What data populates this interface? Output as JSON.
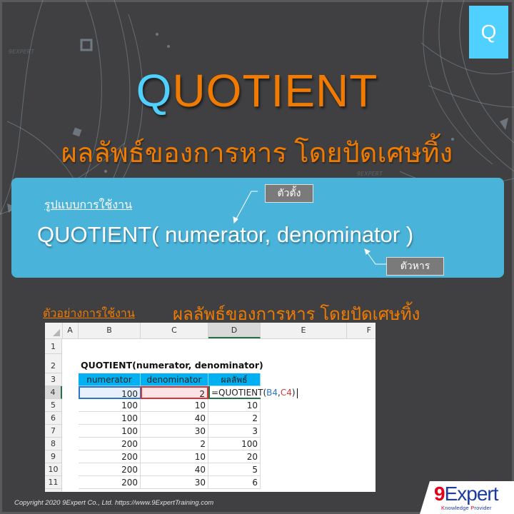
{
  "badge": {
    "letter": "Q"
  },
  "header": {
    "title_first_letter": "Q",
    "title_rest": "UOTIENT",
    "subtitle": "ผลลัพธ์ของการหาร โดยปัดเศษทิ้ง"
  },
  "syntax_panel": {
    "usage_label": "รูปแบบการใช้งาน",
    "syntax": "QUOTIENT( numerator, denominator )",
    "callout_numerator": "ตัวตั้ง",
    "callout_denominator": "ตัวหาร"
  },
  "example": {
    "label": "ตัวอย่างการใช้งาน",
    "title": "ผลลัพธ์ของการหาร โดยปัดเศษทิ้ง"
  },
  "spreadsheet": {
    "columns": [
      "A",
      "B",
      "C",
      "D",
      "E",
      "F"
    ],
    "active_column": "D",
    "rows": [
      "1",
      "2",
      "3",
      "4",
      "5",
      "6",
      "7",
      "8",
      "9",
      "10",
      "11"
    ],
    "active_row": "4",
    "sheet_title": "QUOTIENT(numerator, denominator)",
    "headers": [
      "numerator",
      "denominator",
      "ผลลัพธ์"
    ],
    "formula": {
      "prefix": "=QUOTIENT(",
      "ref_numerator": "B4",
      "separator": ",",
      "ref_denominator": "C4",
      "suffix": ")"
    },
    "data": [
      {
        "numerator": "100",
        "denominator": "2",
        "result": ""
      },
      {
        "numerator": "100",
        "denominator": "10",
        "result": "10"
      },
      {
        "numerator": "100",
        "denominator": "40",
        "result": "2"
      },
      {
        "numerator": "100",
        "denominator": "30",
        "result": "3"
      },
      {
        "numerator": "200",
        "denominator": "2",
        "result": "100"
      },
      {
        "numerator": "200",
        "denominator": "10",
        "result": "20"
      },
      {
        "numerator": "200",
        "denominator": "40",
        "result": "5"
      },
      {
        "numerator": "200",
        "denominator": "30",
        "result": "6"
      }
    ]
  },
  "footer": {
    "copyright": "Copyright 2020 9Expert Co., Ltd.   https://www.9ExpertTraining.com"
  },
  "logo": {
    "nine": "9",
    "word": "Expert",
    "tagline_k": "K",
    "tagline_mid": "nowledge ",
    "tagline_p": "P",
    "tagline_end": "rovider"
  },
  "colors": {
    "accent_blue": "#4fd0ff",
    "accent_orange": "#f07b00",
    "panel_blue": "#4ab3da",
    "background": "#404042",
    "header_cell": "#00b0f0"
  }
}
